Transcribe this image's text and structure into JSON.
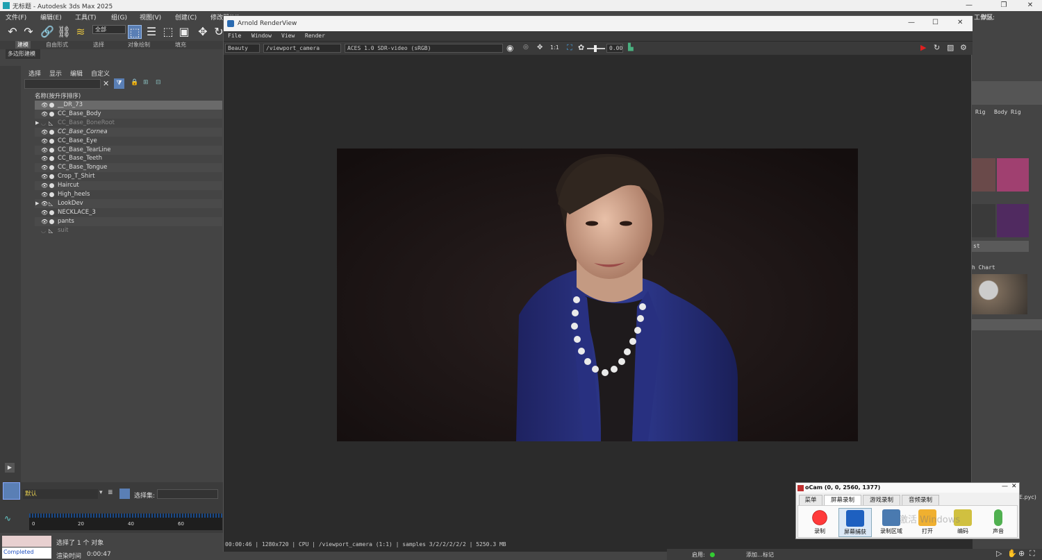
{
  "app": {
    "title": "无标题 - Autodesk 3ds Max 2025",
    "menus": [
      "文件(F)",
      "编辑(E)",
      "工具(T)",
      "组(G)",
      "视图(V)",
      "创建(C)",
      "修改器(M)"
    ],
    "workspace_label": "工作区:",
    "workspace_value": "默认",
    "selection_filter": "全部",
    "ribbon_tabs": [
      "建模",
      "自由形式",
      "选择",
      "对象绘制",
      "填充"
    ],
    "ribbon_sub": "多边形建模"
  },
  "explorer": {
    "menu": [
      "选择",
      "显示",
      "编辑",
      "自定义"
    ],
    "header": "名称(按升序排序)",
    "items": [
      {
        "name": "__DR_73",
        "type": "mesh",
        "selected": true
      },
      {
        "name": "CC_Base_Body",
        "type": "mesh"
      },
      {
        "name": "CC_Base_BoneRoot",
        "type": "bone",
        "hidden": true,
        "expand": true
      },
      {
        "name": "CC_Base_Cornea",
        "type": "mesh",
        "italic": true
      },
      {
        "name": "CC_Base_Eye",
        "type": "mesh"
      },
      {
        "name": "CC_Base_TearLine",
        "type": "mesh"
      },
      {
        "name": "CC_Base_Teeth",
        "type": "mesh"
      },
      {
        "name": "CC_Base_Tongue",
        "type": "mesh"
      },
      {
        "name": "Crop_T_Shirt",
        "type": "mesh"
      },
      {
        "name": "Haircut",
        "type": "mesh"
      },
      {
        "name": "High_heels",
        "type": "mesh"
      },
      {
        "name": "LookDev",
        "type": "bone",
        "expand": true
      },
      {
        "name": "NECKLACE_3",
        "type": "mesh"
      },
      {
        "name": "pants",
        "type": "mesh"
      },
      {
        "name": "suit",
        "type": "bone",
        "hidden": true
      }
    ],
    "layer_value": "默认",
    "selection_set_label": "选择集:"
  },
  "renderview": {
    "title": "Arnold RenderView",
    "menus": [
      "File",
      "Window",
      "View",
      "Render"
    ],
    "aov": "Beauty",
    "camera": "/viewport_camera",
    "display": "ACES 1.0 SDR-video (sRGB)",
    "ratio": "1:1",
    "exposure": "0.00",
    "status": "00:00:46 | 1280x720 | CPU | /viewport_camera (1:1) | samples 3/2/2/2/2/2 | 5250.3 MB"
  },
  "rightpanel": {
    "tabs": [
      "Rig",
      "Body Rig"
    ],
    "labels": [
      "st",
      "h Chart"
    ],
    "footnote": "E.pyc)"
  },
  "timeline": {
    "ticks": [
      "0",
      "20",
      "40",
      "60"
    ]
  },
  "status": {
    "selected": "选择了 1 个 对象",
    "render_time_label": "渲染时间",
    "render_time": "0:00:47",
    "completed": "Completed",
    "enable_label": "启用:",
    "add_tag": "添加…标记"
  },
  "ocam": {
    "title": "oCam (0, 0, 2560, 1377)",
    "tabs": [
      "菜单",
      "屏幕录制",
      "游戏录制",
      "音频录制"
    ],
    "buttons": [
      "录制",
      "屏幕捕获",
      "录制区域",
      "打开",
      "编码",
      "声音"
    ],
    "watermark": "激活 Windows"
  },
  "colors": {
    "accent": "#5a7fb5",
    "record": "#e02020",
    "canvas_bg": "#1b1414",
    "suit": "#2b2f7a"
  }
}
